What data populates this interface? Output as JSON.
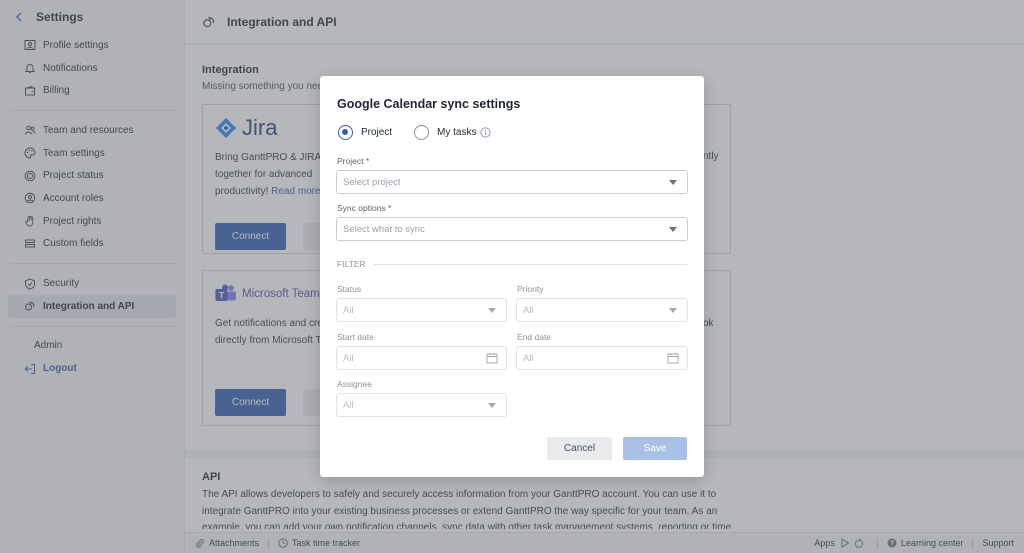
{
  "sidebar": {
    "title": "Settings",
    "groups": [
      [
        {
          "label": "Profile settings",
          "icon": "user-card-icon"
        },
        {
          "label": "Notifications",
          "icon": "bell-icon"
        },
        {
          "label": "Billing",
          "icon": "wallet-icon"
        }
      ],
      [
        {
          "label": "Team and resources",
          "icon": "team-icon"
        },
        {
          "label": "Team settings",
          "icon": "palette-icon"
        },
        {
          "label": "Project status",
          "icon": "target-icon"
        },
        {
          "label": "Account roles",
          "icon": "role-icon"
        },
        {
          "label": "Project rights",
          "icon": "hand-icon"
        },
        {
          "label": "Custom fields",
          "icon": "list-icon"
        }
      ],
      [
        {
          "label": "Security",
          "icon": "shield-icon"
        },
        {
          "label": "Integration and API",
          "icon": "integration-icon",
          "active": true
        }
      ]
    ],
    "admin": "Admin",
    "logout": "Logout"
  },
  "header": {
    "title": "Integration and API"
  },
  "integration": {
    "title": "Integration",
    "subtitle": "Missing something you nee",
    "jira": {
      "name": "Jira",
      "desc_line1": "Bring GanttPRO & JIRA S",
      "desc_line2": "together for advanced",
      "desc_line3": "productivity!",
      "read_more": "Read more",
      "connect": "Connect",
      "right_tail": "ntly"
    },
    "teams": {
      "name": "Microsoft Teams",
      "desc_line1": "Get notifications and cre",
      "desc_line2": "directly from Microsoft T",
      "connect": "Connect",
      "right_tail": "ok"
    }
  },
  "api": {
    "title": "API",
    "desc": "The API allows developers to safely and securely access information from your GanttPRO account. You can use it to integrate GanttPRO into your existing business processes or extend GanttPRO the way specific for your team. As an example, you can add your own notification channels, sync data with other task management systems, reporting or time"
  },
  "footer": {
    "attachments": "Attachments",
    "task_tracker": "Task time tracker",
    "apps": "Apps",
    "learning": "Learning center",
    "support": "Support"
  },
  "modal": {
    "title": "Google Calendar sync settings",
    "radio_project": "Project",
    "radio_my_tasks": "My tasks",
    "project_label": "Project *",
    "project_placeholder": "Select project",
    "sync_label": "Sync options *",
    "sync_placeholder": "Select what to sync",
    "filter": "FILTER",
    "status_label": "Status",
    "status_value": "All",
    "priority_label": "Priority",
    "priority_value": "All",
    "start_label": "Start date",
    "start_value": "All",
    "end_label": "End date",
    "end_value": "All",
    "assignee_label": "Assignee",
    "assignee_value": "All",
    "cancel": "Cancel",
    "save": "Save"
  },
  "colors": {
    "accent": "#2f5fb3",
    "save_disabled": "#a9c0e6",
    "jira_blue": "#2684ff",
    "teams_purple": "#5059c9"
  }
}
